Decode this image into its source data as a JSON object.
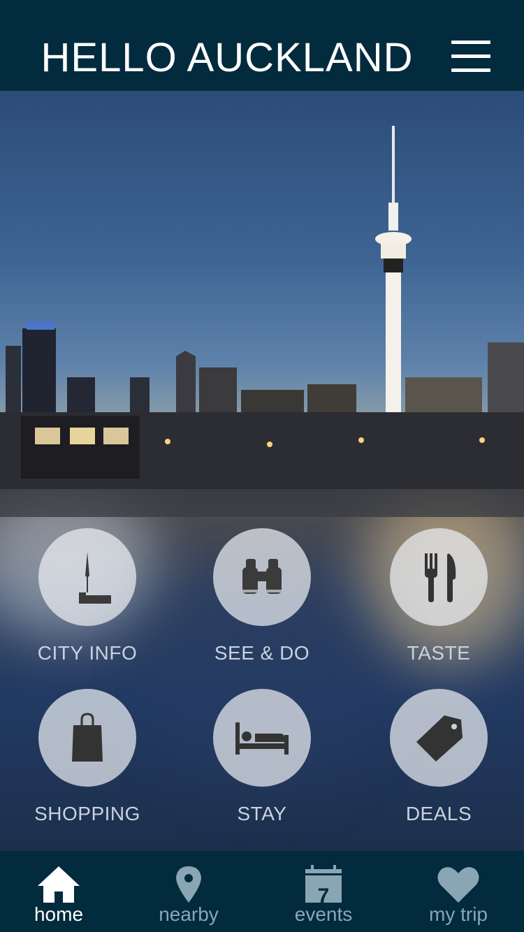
{
  "header": {
    "title": "HELLO AUCKLAND",
    "menu_icon": "hamburger-menu-icon"
  },
  "tiles": [
    {
      "label": "CITY INFO",
      "icon": "sky-tower-icon"
    },
    {
      "label": "SEE & DO",
      "icon": "binoculars-icon"
    },
    {
      "label": "TASTE",
      "icon": "fork-knife-icon"
    },
    {
      "label": "SHOPPING",
      "icon": "shopping-bag-icon"
    },
    {
      "label": "STAY",
      "icon": "bed-icon"
    },
    {
      "label": "DEALS",
      "icon": "price-tag-icon"
    }
  ],
  "tabbar": {
    "active": "home",
    "items": [
      {
        "label": "home",
        "icon": "home-icon"
      },
      {
        "label": "nearby",
        "icon": "map-pin-icon"
      },
      {
        "label": "events",
        "icon": "calendar-icon",
        "day": "7"
      },
      {
        "label": "my trip",
        "icon": "heart-icon"
      }
    ]
  },
  "colors": {
    "bar_bg": "#022b3d",
    "tab_inactive": "#8aa6b5",
    "tab_active": "#ffffff"
  }
}
